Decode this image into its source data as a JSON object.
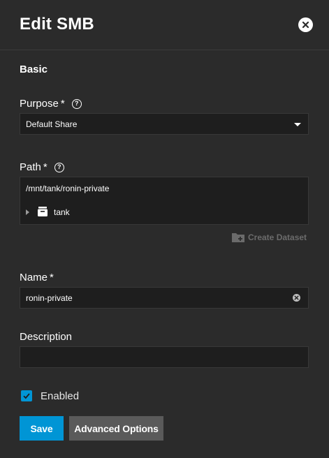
{
  "dialog": {
    "title": "Edit SMB",
    "section": "Basic"
  },
  "purpose": {
    "label": "Purpose",
    "required": "*",
    "value": "Default Share"
  },
  "path": {
    "label": "Path",
    "required": "*",
    "value": "/mnt/tank/ronin-private",
    "tree_item": "tank",
    "create_dataset": "Create Dataset"
  },
  "name": {
    "label": "Name",
    "required": "*",
    "value": "ronin-private"
  },
  "description": {
    "label": "Description",
    "value": ""
  },
  "enabled": {
    "label": "Enabled",
    "checked": true
  },
  "buttons": {
    "save": "Save",
    "advanced": "Advanced Options"
  },
  "colors": {
    "accent": "#0095d5",
    "background": "#2b2b2b",
    "field": "#1e1e1e"
  }
}
